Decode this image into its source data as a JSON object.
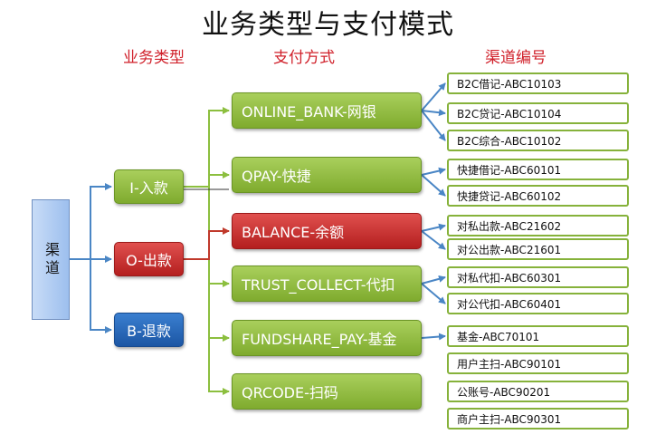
{
  "title": "业务类型与支付模式",
  "headers": {
    "business_type": "业务类型",
    "payment_method": "支付方式",
    "channel_code": "渠道编号"
  },
  "source": {
    "label": "渠道"
  },
  "business_types": [
    {
      "label": "I-入款",
      "color": "green"
    },
    {
      "label": "O-出款",
      "color": "red"
    },
    {
      "label": "B-退款",
      "color": "blue"
    }
  ],
  "payment_methods": [
    {
      "label": "ONLINE_BANK-网银",
      "color": "green"
    },
    {
      "label": "QPAY-快捷",
      "color": "green"
    },
    {
      "label": "BALANCE-余额",
      "color": "red"
    },
    {
      "label": "TRUST_COLLECT-代扣",
      "color": "green"
    },
    {
      "label": "FUNDSHARE_PAY-基金",
      "color": "green"
    },
    {
      "label": "QRCODE-扫码",
      "color": "green"
    }
  ],
  "channels": [
    {
      "label": "B2C借记-ABC10103"
    },
    {
      "label": "B2C贷记-ABC10104"
    },
    {
      "label": "B2C综合-ABC10102"
    },
    {
      "label": "快捷借记-ABC60101"
    },
    {
      "label": "快捷贷记-ABC60102"
    },
    {
      "label": "对私出款-ABC21602"
    },
    {
      "label": "对公出款-ABC21601"
    },
    {
      "label": "对私代扣-ABC60301"
    },
    {
      "label": "对公代扣-ABC60401"
    },
    {
      "label": "基金-ABC70101"
    },
    {
      "label": "用户主扫-ABC90101"
    },
    {
      "label": "公账号-ABC90201"
    },
    {
      "label": "商户主扫-ABC90301"
    }
  ],
  "colors": {
    "header_red": "#d0202a",
    "connector_blue": "#4a86c5",
    "connector_green": "#8cbf3f",
    "connector_red": "#c0392b"
  }
}
